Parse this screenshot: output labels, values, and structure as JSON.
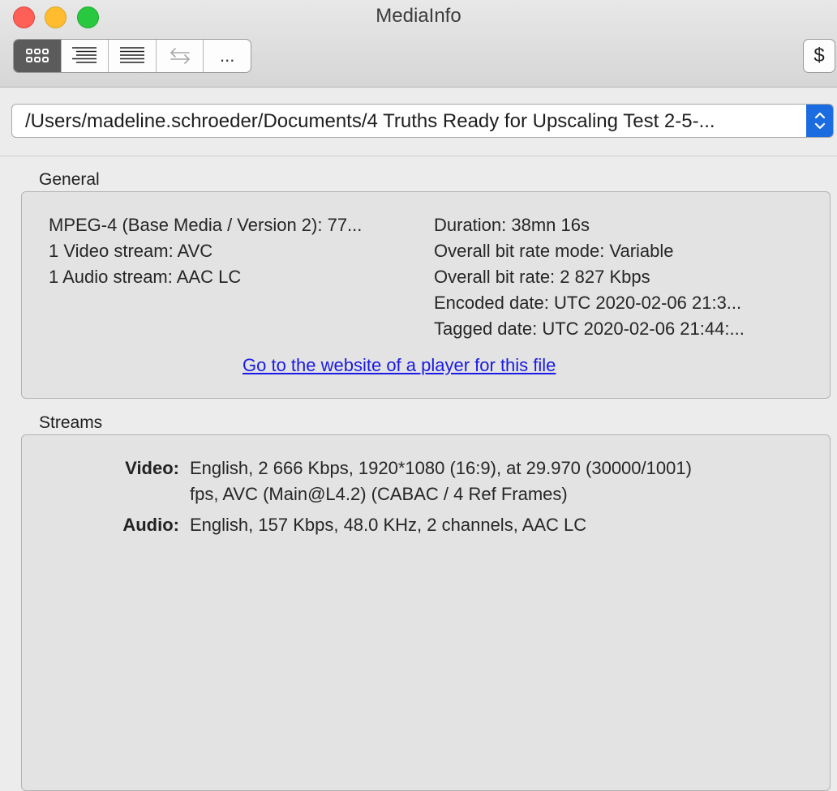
{
  "window": {
    "title": "MediaInfo"
  },
  "toolbar": {
    "views": [
      {
        "name": "basic-view",
        "icon": "grid-icon"
      },
      {
        "name": "sheet-view",
        "icon": "indented-list-icon"
      },
      {
        "name": "text-view",
        "icon": "lines-icon"
      },
      {
        "name": "compare-view",
        "icon": "arrows-icon"
      },
      {
        "name": "more-views",
        "icon": "ellipsis-icon",
        "label": "..."
      }
    ],
    "donate_label": "$"
  },
  "file": {
    "path": "/Users/madeline.schroeder/Documents/4 Truths Ready for Upscaling Test 2-5-..."
  },
  "general": {
    "heading": "General",
    "left": [
      "MPEG-4 (Base Media / Version 2): 77...",
      "1 Video stream: AVC",
      "1 Audio stream: AAC LC"
    ],
    "right": [
      "Duration: 38mn 16s",
      "Overall bit rate mode: Variable",
      "Overall bit rate: 2 827 Kbps",
      "Encoded date: UTC 2020-02-06 21:3...",
      "Tagged date: UTC 2020-02-06 21:44:..."
    ],
    "player_link": "Go to the website of a player for this file"
  },
  "streams": {
    "heading": "Streams",
    "video": {
      "label": "Video:",
      "line1": "English, 2 666 Kbps, 1920*1080 (16:9), at 29.970 (30000/1001)",
      "line2": "fps, AVC (Main@L4.2) (CABAC / 4 Ref Frames)"
    },
    "audio": {
      "label": "Audio:",
      "line1": "English, 157 Kbps, 48.0 KHz, 2 channels, AAC LC"
    }
  }
}
